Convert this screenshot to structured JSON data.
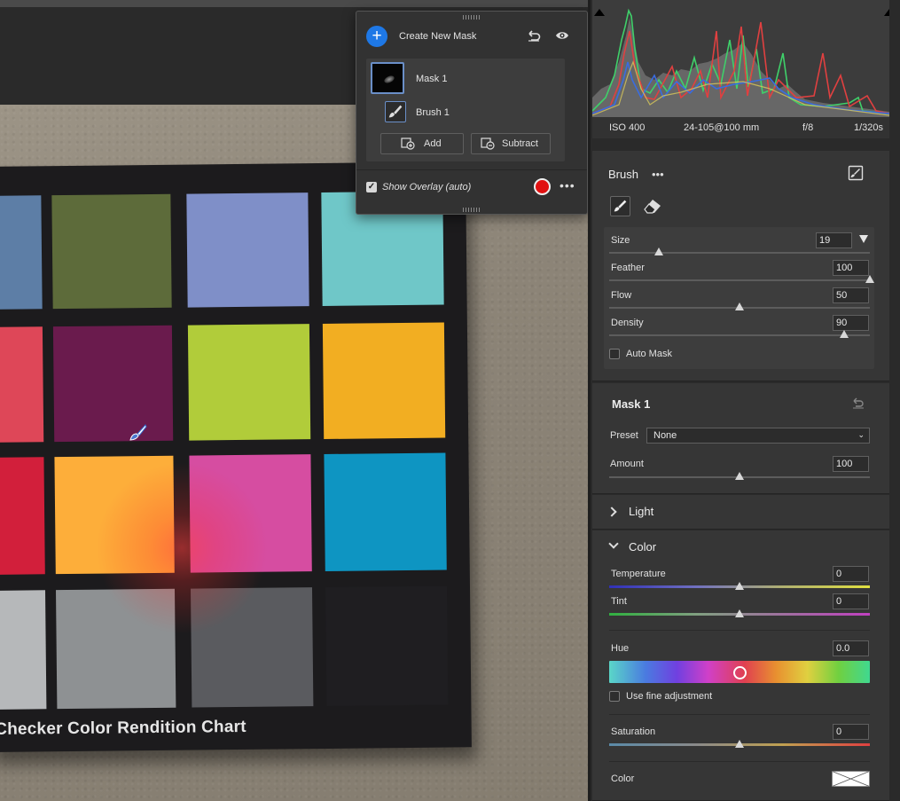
{
  "chart_caption": "rChecker Color Rendition Chart",
  "chart_patches": [
    "#5d7ea6",
    "#5d6b3a",
    "#7f8fc8",
    "#6fc7c8",
    "#de4758",
    "#6a1b4d",
    "#b1cc3a",
    "#f2ae22",
    "#d21f3b",
    "#fdae3a",
    "#d64da1",
    "#0e95c2",
    "#b6b8ba",
    "#8e9193",
    "#5a5b5f",
    "#1f1e21"
  ],
  "mask_popup": {
    "create_label": "Create New Mask",
    "mask_name": "Mask 1",
    "brush_name": "Brush 1",
    "add_label": "Add",
    "subtract_label": "Subtract",
    "show_overlay_label": "Show Overlay (auto)",
    "overlay_color": "#e11111",
    "more_glyph": "•••"
  },
  "camera_info": {
    "iso": "ISO 400",
    "lens": "24-105@100 mm",
    "aperture": "f/8",
    "shutter": "1/320s"
  },
  "brush_panel": {
    "title": "Brush",
    "more_glyph": "•••",
    "size_label": "Size",
    "size_value": "19",
    "size_level": 0.19,
    "feather_label": "Feather",
    "feather_value": "100",
    "feather_level": 1.0,
    "flow_label": "Flow",
    "flow_value": "50",
    "flow_level": 0.5,
    "density_label": "Density",
    "density_value": "90",
    "density_level": 0.9,
    "auto_mask_label": "Auto Mask"
  },
  "mask_panel": {
    "title": "Mask 1",
    "preset_label": "Preset",
    "preset_value": "None",
    "amount_label": "Amount",
    "amount_value": "100"
  },
  "light_section": {
    "title": "Light"
  },
  "color_section": {
    "title": "Color",
    "temperature_label": "Temperature",
    "temperature_value": "0",
    "tint_label": "Tint",
    "tint_value": "0",
    "hue_label": "Hue",
    "hue_value": "0.0",
    "fine_adjust_label": "Use fine adjustment",
    "saturation_label": "Saturation",
    "saturation_value": "0",
    "color_label": "Color"
  },
  "accent_color": "#1e78e6"
}
